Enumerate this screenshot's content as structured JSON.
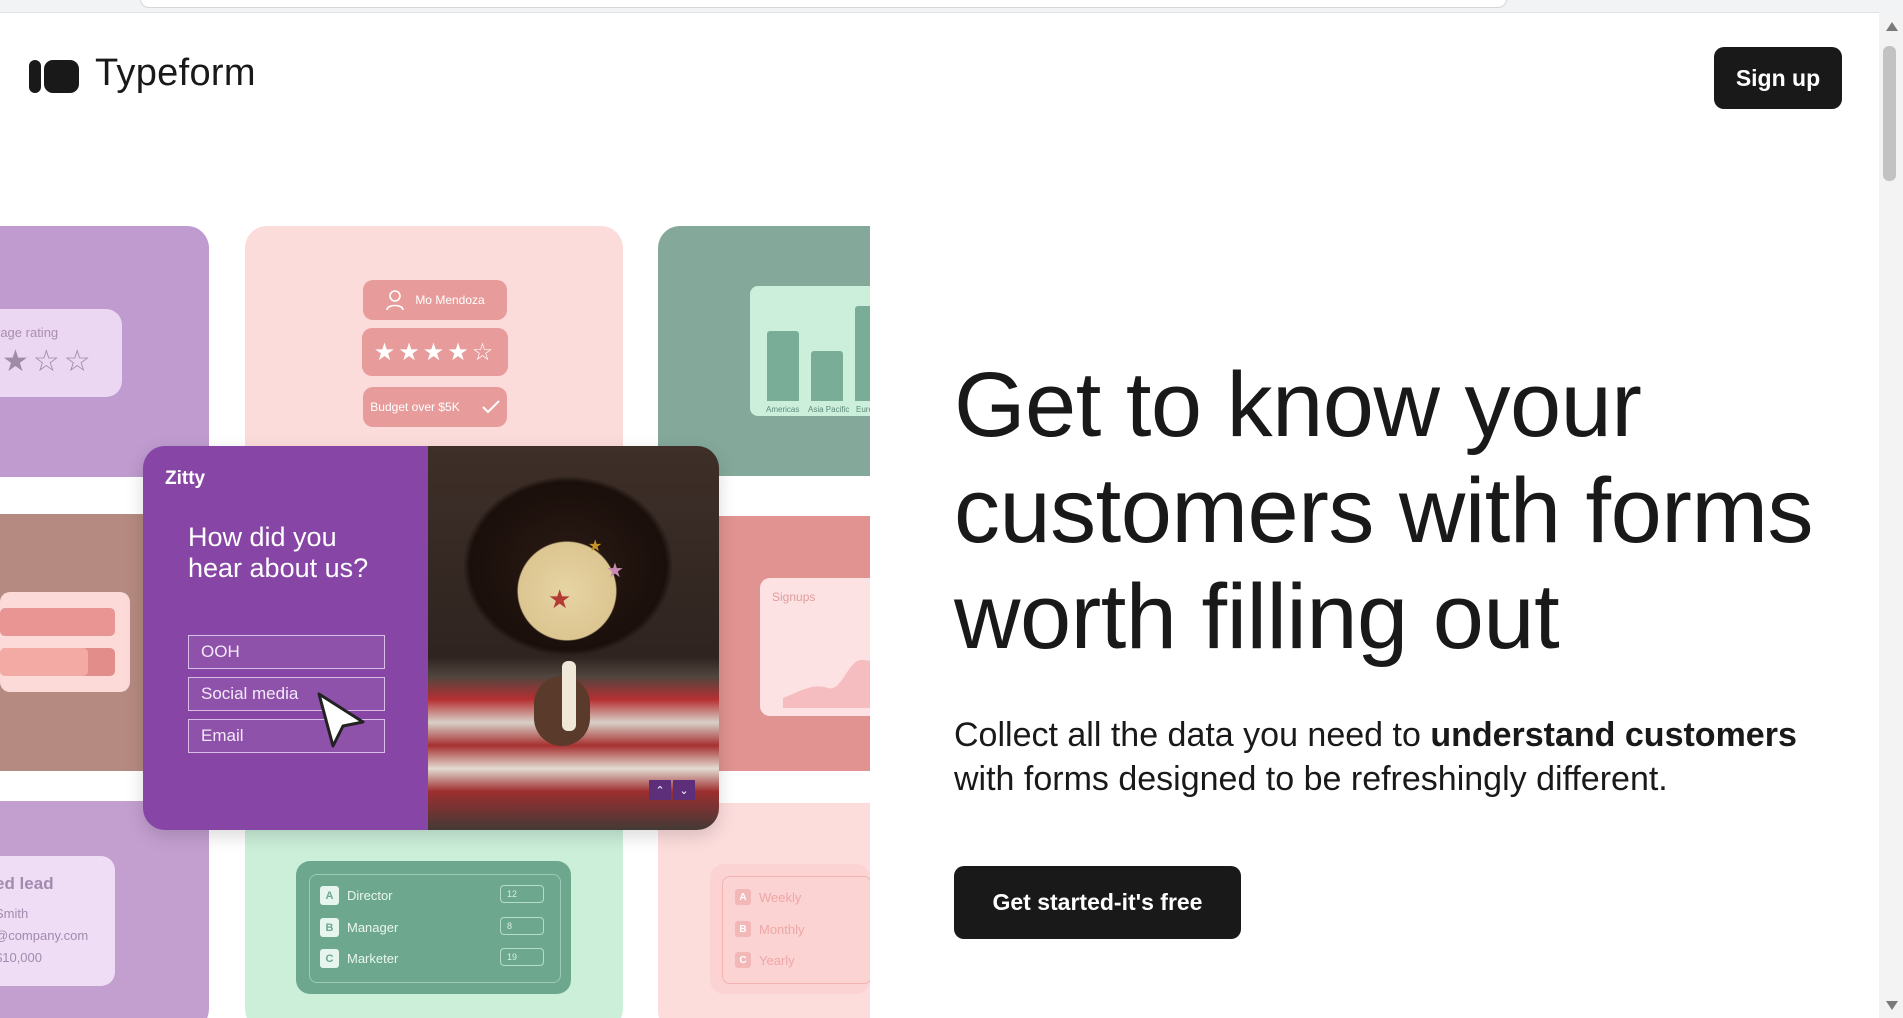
{
  "header": {
    "logo_text": "Typeform",
    "signup_label": "Sign up"
  },
  "hero": {
    "title": "Get to know your customers with forms worth filling out",
    "subtitle_before": "Collect all the data you need to ",
    "subtitle_bold": "understand customers",
    "subtitle_after": " with forms designed to be refreshingly different.",
    "cta_label": "Get started-it's free"
  },
  "collage": {
    "rating_label": "rage rating",
    "rating_stars": "★☆☆",
    "profile_name": "Mo Mendoza",
    "review_stars": "★★★★☆",
    "budget_chip": "Budget over $5K",
    "chart_regions": [
      "Americas",
      "Asia Pacific",
      "Euro"
    ],
    "signups_title": "Signups",
    "lead_title": "ed lead",
    "lead_lines": [
      " Smith",
      "@company.com",
      "$10,000"
    ],
    "roles": [
      {
        "key": "A",
        "label": "Director",
        "value": "12"
      },
      {
        "key": "B",
        "label": "Manager",
        "value": "8"
      },
      {
        "key": "C",
        "label": "Marketer",
        "value": "19"
      }
    ],
    "frequencies": [
      {
        "key": "A",
        "label": "Weekly"
      },
      {
        "key": "B",
        "label": "Monthly"
      },
      {
        "key": "C",
        "label": "Yearly"
      }
    ],
    "form": {
      "brand": "Zitty",
      "question": "How did you hear about us?",
      "options": [
        "OOH",
        "Social media",
        "Email"
      ]
    }
  },
  "icons": {
    "logo": "typeform-logo-icon",
    "person": "person-icon",
    "check": "check-icon",
    "cursor": "cursor-icon",
    "nav_up": "chevron-up-icon",
    "nav_down": "chevron-down-icon"
  },
  "colors": {
    "brand_dark": "#191919",
    "form_purple": "#8745a5"
  }
}
